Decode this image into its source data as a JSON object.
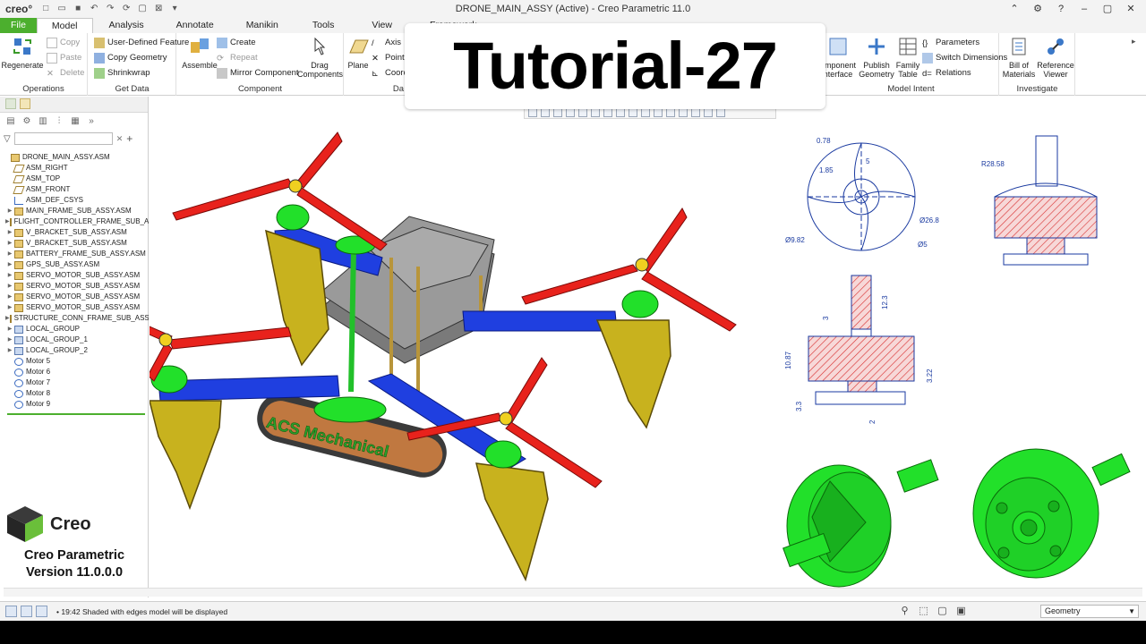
{
  "app": {
    "logo": "creo°",
    "window_title": "DRONE_MAIN_ASSY (Active) - Creo Parametric 11.0"
  },
  "tabs": [
    {
      "label": "File"
    },
    {
      "label": "Model"
    },
    {
      "label": "Analysis"
    },
    {
      "label": "Annotate"
    },
    {
      "label": "Manikin"
    },
    {
      "label": "Tools"
    },
    {
      "label": "View"
    },
    {
      "label": "Framework"
    }
  ],
  "ribbon": {
    "operations": {
      "label": "Operations",
      "regenerate": "Regenerate",
      "copy": "Copy",
      "paste": "Paste",
      "delete": "Delete"
    },
    "get_data": {
      "label": "Get Data",
      "udf": "User-Defined Feature",
      "copy_geometry": "Copy Geometry",
      "shrinkwrap": "Shrinkwrap"
    },
    "component": {
      "label": "Component",
      "assemble": "Assemble",
      "create": "Create",
      "repeat": "Repeat",
      "mirror": "Mirror Component",
      "drag": "Drag Components"
    },
    "datum": {
      "label": "Da",
      "plane": "Plane",
      "axis": "Axis",
      "point": "Point",
      "coord": "Coord"
    },
    "model_intent": {
      "label": "Model Intent",
      "component_interface": "omponent nterface",
      "publish_geometry": "Publish Geometry",
      "family_table": "Family Table",
      "parameters": "Parameters",
      "switch_dimensions": "Switch Dimensions",
      "relations": "Relations"
    },
    "investigate": {
      "label": "Investigate",
      "bom": "Bill of Materials",
      "reference_viewer": "Reference Viewer"
    }
  },
  "overlay_title": "Tutorial-27",
  "model_tree": {
    "filter_placeholder": "",
    "items": [
      {
        "label": "DRONE_MAIN_ASSY.ASM",
        "type": "asm",
        "depth": 0,
        "expand": false
      },
      {
        "label": "ASM_RIGHT",
        "type": "plane",
        "depth": 1,
        "expand": false
      },
      {
        "label": "ASM_TOP",
        "type": "plane",
        "depth": 1,
        "expand": false
      },
      {
        "label": "ASM_FRONT",
        "type": "plane",
        "depth": 1,
        "expand": false
      },
      {
        "label": "ASM_DEF_CSYS",
        "type": "csys",
        "depth": 1,
        "expand": false
      },
      {
        "label": "MAIN_FRAME_SUB_ASSY.ASM",
        "type": "asm",
        "depth": 1,
        "expand": true
      },
      {
        "label": "FLIGHT_CONTROLLER_FRAME_SUB_A",
        "type": "asm",
        "depth": 1,
        "expand": true
      },
      {
        "label": "V_BRACKET_SUB_ASSY.ASM",
        "type": "asm",
        "depth": 1,
        "expand": true
      },
      {
        "label": "V_BRACKET_SUB_ASSY.ASM",
        "type": "asm",
        "depth": 1,
        "expand": true
      },
      {
        "label": "BATTERY_FRAME_SUB_ASSY.ASM",
        "type": "asm",
        "depth": 1,
        "expand": true
      },
      {
        "label": "GPS_SUB_ASSY.ASM",
        "type": "asm",
        "depth": 1,
        "expand": true
      },
      {
        "label": "SERVO_MOTOR_SUB_ASSY.ASM",
        "type": "asm",
        "depth": 1,
        "expand": true
      },
      {
        "label": "SERVO_MOTOR_SUB_ASSY.ASM",
        "type": "asm",
        "depth": 1,
        "expand": true
      },
      {
        "label": "SERVO_MOTOR_SUB_ASSY.ASM",
        "type": "asm",
        "depth": 1,
        "expand": true
      },
      {
        "label": "SERVO_MOTOR_SUB_ASSY.ASM",
        "type": "asm",
        "depth": 1,
        "expand": true
      },
      {
        "label": "STRUCTURE_CONN_FRAME_SUB_ASSY",
        "type": "asm",
        "depth": 1,
        "expand": true
      },
      {
        "label": "LOCAL_GROUP",
        "type": "group",
        "depth": 1,
        "expand": true
      },
      {
        "label": "LOCAL_GROUP_1",
        "type": "group",
        "depth": 1,
        "expand": true
      },
      {
        "label": "LOCAL_GROUP_2",
        "type": "group",
        "depth": 1,
        "expand": true
      },
      {
        "label": "Motor 5",
        "type": "motor",
        "depth": 1,
        "expand": false
      },
      {
        "label": "Motor 6",
        "type": "motor",
        "depth": 1,
        "expand": false
      },
      {
        "label": "Motor 7",
        "type": "motor",
        "depth": 1,
        "expand": false
      },
      {
        "label": "Motor 8",
        "type": "motor",
        "depth": 1,
        "expand": false
      },
      {
        "label": "Motor 9",
        "type": "motor",
        "depth": 1,
        "expand": false
      }
    ]
  },
  "branding": {
    "logo_text": "Creo",
    "product": "Creo Parametric",
    "version": "Version 11.0.0.0"
  },
  "model_label": "ACS Mechanical",
  "drawing": {
    "dims_top": [
      "0.78",
      "1.85",
      "5",
      "Ø9.82",
      "Ø26.8",
      "Ø5"
    ],
    "dims_side": [
      "R28.58"
    ],
    "dims_section": [
      "12.3",
      "3",
      "10.87",
      "3.22",
      "3.3",
      "2"
    ]
  },
  "status": {
    "message": "• 19:42  Shaded with edges model will be displayed",
    "filter_value": "Geometry"
  },
  "colors": {
    "file_tab": "#4caf2e",
    "part_green": "#22e02a",
    "propeller_red": "#e8221c",
    "frame_blue": "#1f3fe0",
    "bracket_gold": "#c8b21e",
    "hatch_red": "#d83030"
  }
}
